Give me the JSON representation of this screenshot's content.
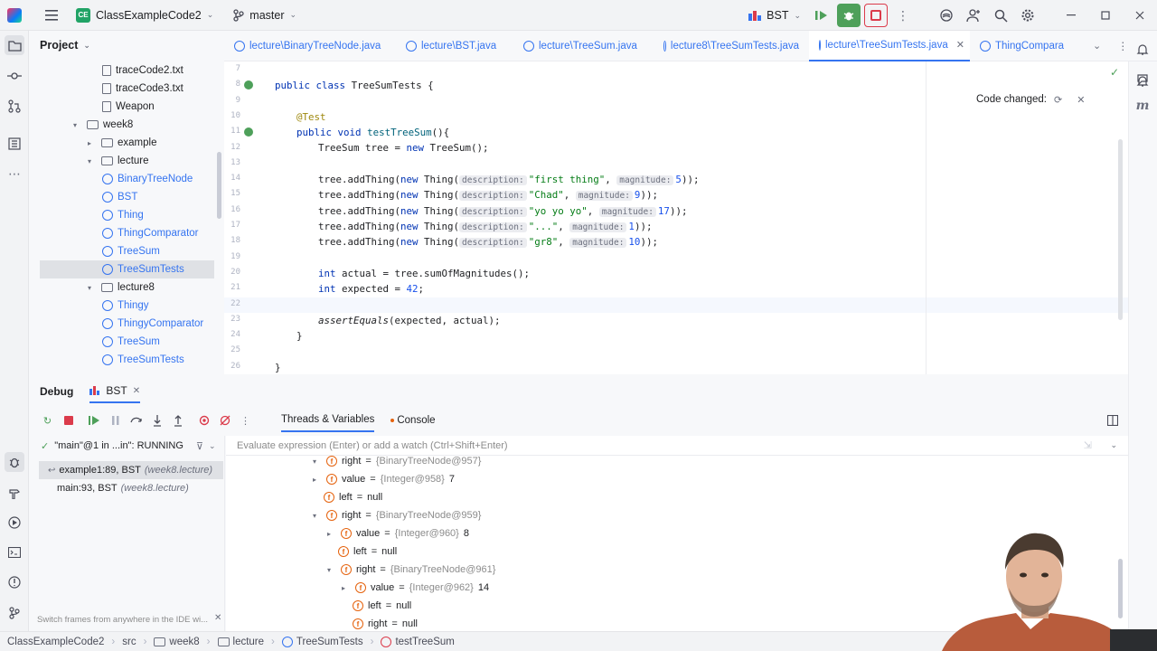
{
  "titlebar": {
    "project_badge": "CE",
    "project_name": "ClassExampleCode2",
    "branch": "master",
    "run_config": "BST"
  },
  "project_panel": {
    "title": "Project",
    "items": [
      {
        "label": "traceCode2.txt",
        "kind": "file"
      },
      {
        "label": "traceCode3.txt",
        "kind": "file"
      },
      {
        "label": "Weapon",
        "kind": "file"
      },
      {
        "label": "week8",
        "kind": "folder"
      },
      {
        "label": "example",
        "kind": "folder"
      },
      {
        "label": "lecture",
        "kind": "folder"
      },
      {
        "label": "BinaryTreeNode",
        "kind": "class"
      },
      {
        "label": "BST",
        "kind": "class"
      },
      {
        "label": "Thing",
        "kind": "class"
      },
      {
        "label": "ThingComparator",
        "kind": "class"
      },
      {
        "label": "TreeSum",
        "kind": "class"
      },
      {
        "label": "TreeSumTests",
        "kind": "class"
      },
      {
        "label": "lecture8",
        "kind": "folder"
      },
      {
        "label": "Thingy",
        "kind": "class"
      },
      {
        "label": "ThingyComparator",
        "kind": "class"
      },
      {
        "label": "TreeSum",
        "kind": "class"
      },
      {
        "label": "TreeSumTests",
        "kind": "class"
      }
    ]
  },
  "tabs": [
    {
      "label": "lecture\\BinaryTreeNode.java"
    },
    {
      "label": "lecture\\BST.java"
    },
    {
      "label": "lecture\\TreeSum.java"
    },
    {
      "label": "lecture8\\TreeSumTests.java"
    },
    {
      "label": "lecture\\TreeSumTests.java"
    },
    {
      "label": "ThingCompara"
    }
  ],
  "editor": {
    "line_numbers": [
      "7",
      "8",
      "9",
      "10",
      "11",
      "12",
      "13",
      "14",
      "15",
      "16",
      "17",
      "18",
      "19",
      "20",
      "21",
      "22",
      "23",
      "24",
      "25",
      "26"
    ],
    "code": {
      "l8_public": "public",
      "l8_class": "class",
      "l8_name": "TreeSumTests {",
      "l10_ann": "@Test",
      "l11_public": "public",
      "l11_void": "void",
      "l11_fn": "testTreeSum",
      "l11_rest": "(){",
      "l12_a": "TreeSum tree = ",
      "l12_new": "new",
      "l12_b": " TreeSum();",
      "add_prefix": "tree.addThing(",
      "new_kw": "new",
      "thing_open": " Thing(",
      "desc_hint": "description:",
      "mag_hint": "magnitude:",
      "adds": [
        {
          "desc": "\"first thing\"",
          "mag": "5"
        },
        {
          "desc": "\"Chad\"",
          "mag": "9"
        },
        {
          "desc": "\"yo yo yo\"",
          "mag": "17"
        },
        {
          "desc": "\"...\"",
          "mag": "1"
        },
        {
          "desc": "\"gr8\"",
          "mag": "10"
        }
      ],
      "close": "));",
      "l20_int": "int",
      "l20_rest": " actual = tree.sumOfMagnitudes();",
      "l21_int": "int",
      "l21_a": " expected = ",
      "l21_num": "42",
      "l21_semi": ";",
      "l23_fn": "assertEquals",
      "l23_rest": "(expected, actual);",
      "l24": "}",
      "l26": "}"
    },
    "notification": "Code changed:"
  },
  "debug": {
    "title": "Debug",
    "session_tab": "BST",
    "threads_tab": "Threads & Variables",
    "console_tab": "Console",
    "thread_selector": "\"main\"@1 in ...in\": RUNNING",
    "eval_placeholder": "Evaluate expression (Enter) or add a watch (Ctrl+Shift+Enter)",
    "frames": [
      {
        "method": "example1:89, BST",
        "pkg": "(week8.lecture)"
      },
      {
        "method": "main:93, BST",
        "pkg": "(week8.lecture)"
      }
    ],
    "frames_hint": "Switch frames from anywhere in the IDE wi...",
    "variables": [
      {
        "name": "right",
        "ref": "{BinaryTreeNode@957}",
        "value": ""
      },
      {
        "name": "value",
        "ref": "{Integer@958}",
        "value": "7"
      },
      {
        "name": "left",
        "ref": "",
        "value": "null"
      },
      {
        "name": "right",
        "ref": "{BinaryTreeNode@959}",
        "value": ""
      },
      {
        "name": "value",
        "ref": "{Integer@960}",
        "value": "8"
      },
      {
        "name": "left",
        "ref": "",
        "value": "null"
      },
      {
        "name": "right",
        "ref": "{BinaryTreeNode@961}",
        "value": ""
      },
      {
        "name": "value",
        "ref": "{Integer@962}",
        "value": "14"
      },
      {
        "name": "left",
        "ref": "",
        "value": "null"
      },
      {
        "name": "right",
        "ref": "",
        "value": "null"
      }
    ]
  },
  "statusbar": {
    "crumbs": [
      "ClassExampleCode2",
      "src",
      "week8",
      "lecture",
      "TreeSumTests",
      "testTreeSum"
    ]
  }
}
